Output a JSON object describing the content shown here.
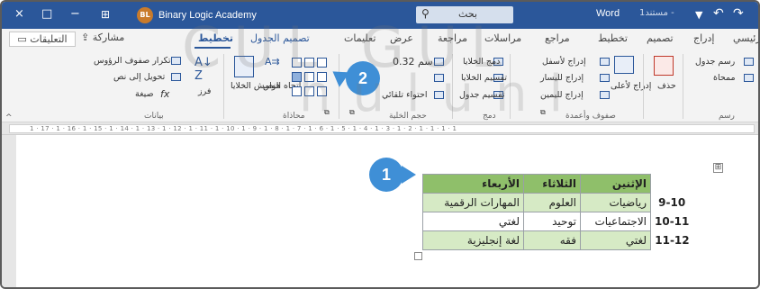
{
  "titlebar": {
    "close_icon": "×",
    "maximize_icon": "□",
    "minimize_icon": "−",
    "display_icon": "⊞",
    "avatar_initials": "BL",
    "user_name": "Binary Logic Academy",
    "search_text": "بحث",
    "search_icon": "⚲",
    "doc_name": "Word",
    "doc_sub": "مستند1 -",
    "save_icon": "▼",
    "undo_icon": "↶",
    "redo_icon": "↷"
  },
  "tabs": {
    "comments": "التعليقات",
    "share": "مشاركة",
    "layout": "تخطيط",
    "table_design": "تصميم الجدول",
    "help": "تعليمات",
    "view": "عرض",
    "review": "مراجعة",
    "mailings": "مراسلات",
    "references": "مراجع",
    "layout2": "تخطيط",
    "design": "تصميم",
    "insert": "إدراج",
    "home": "رئيسي"
  },
  "ribbon": {
    "repeat_header": "تكرار صفوف الرؤوس",
    "convert_text": "تحويل إلى نص",
    "formula": "صيغة",
    "sort": "فرز",
    "data_group": "بيانات",
    "cell_margins": "هوامش الخلايا",
    "text_direction": "اتجاه النص",
    "alignment_group": "محاذاة",
    "height_value": "0.32 سم",
    "autofit": "احتواء تلقائي",
    "cell_size_group": "حجم الخلية",
    "merge_cells": "دمج الخلايا",
    "split_cells": "تقسيم الخلايا",
    "split_table": "تقسيم جدول",
    "merge_group": "دمج",
    "insert_below": "إدراج لأسفل",
    "insert_left": "إدراج لليسار",
    "insert_right": "إدراج لليمين",
    "insert_above": "إدراج لأعلى",
    "rows_cols_group": "صفوف وأعمدة",
    "delete": "حذف",
    "draw_table": "رسم جدول",
    "eraser": "ممحاة",
    "draw_group": "رسم"
  },
  "ruler": {
    "text": "1 · 17 · 1 · 16 · 1 · 15 · 1 · 14 · 1 · 13 · 1 · 12 · 1 · 11 · 1 · 10 · 1 · 9 · 1 · 8 · 1 · 7 · 1 · 6 · 1 · 5 · 1 · 4 · 1 · 3 · 1 · 2 · 1 · 1 · 1 · 1"
  },
  "table": {
    "headers": [
      "الأربعاء",
      "الثلاثاء",
      "الإثنين"
    ],
    "rows": [
      {
        "time": "9-10",
        "mon": "رياضيات",
        "tue": "العلوم",
        "wed": "المهارات الرقمية"
      },
      {
        "time": "10-11",
        "mon": "الاجتماعيات",
        "tue": "توحيد",
        "wed": "لغتي"
      },
      {
        "time": "11-12",
        "mon": "لغتي",
        "tue": "فقه",
        "wed": "لغة إنجليزية"
      }
    ],
    "move_handle": "⊞"
  },
  "callouts": {
    "one": "1",
    "two": "2"
  },
  "watermark": {
    "line1": "CUL GUL",
    "line2": "hulunl"
  },
  "colors": {
    "titlebar": "#2b579a",
    "table_header": "#8fbf6a",
    "table_band": "#d6eac5",
    "callout": "#3f8fd6"
  }
}
